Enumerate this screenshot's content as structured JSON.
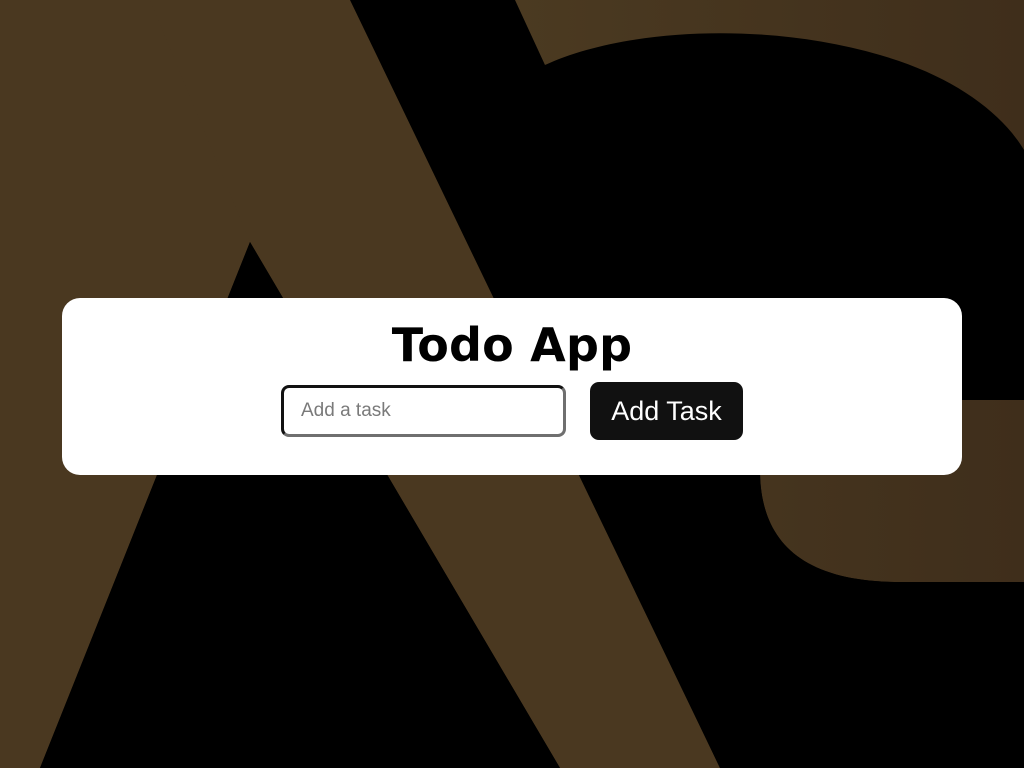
{
  "app": {
    "title": "Todo App"
  },
  "form": {
    "input_value": "",
    "input_placeholder": "Add a task",
    "add_button_label": "Add Task"
  },
  "colors": {
    "page_background": "#000000",
    "background_shape": "#4a3820",
    "card_background": "#ffffff",
    "button_background": "#111111",
    "button_text": "#ffffff"
  },
  "icons": {
    "background": "ac-logo-graphic"
  }
}
